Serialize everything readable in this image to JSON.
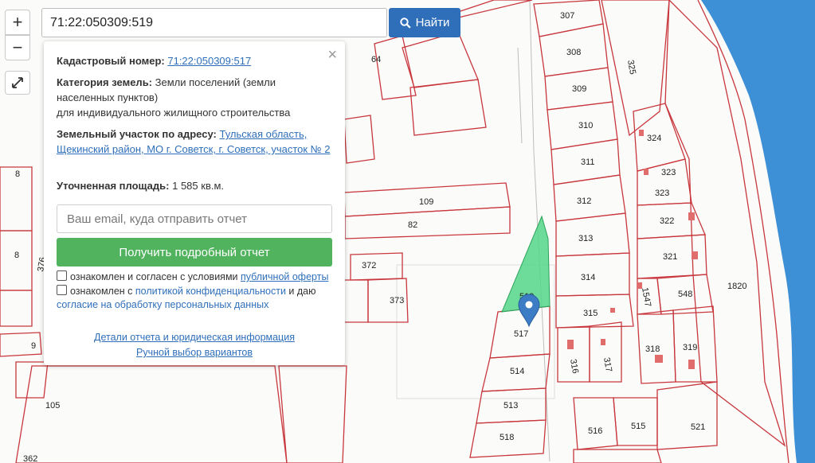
{
  "search": {
    "value": "71:22:050309:519",
    "button_label": "Найти"
  },
  "zoom": {
    "in_label": "+",
    "out_label": "−"
  },
  "popup": {
    "cadastral_label": "Кадастровый номер:",
    "cadastral_value": "71:22:050309:517",
    "category_label": "Категория земель:",
    "category_value": "Земли поселений (земли населенных пунктов)",
    "category_use": "для индивидуального жилищного строительства",
    "address_label": "Земельный участок по адресу:",
    "address_value": "Тульская область, Щекинский район, МО г. Советск, г. Советск, участок № 2",
    "area_label": "Уточненная площадь:",
    "area_value": "1 585 кв.м.",
    "email_placeholder": "Ваш email, куда отправить отчет",
    "report_button": "Получить подробный отчет",
    "consent1_text": "ознакомлен и согласен с условиями ",
    "consent1_link": "публичной оферты",
    "consent2_text": "ознакомлен с ",
    "consent2_link": "политикой конфиденциальности",
    "consent2_text2": " и даю",
    "consent2_link2": "согласие на обработку персональных данных",
    "details_link": "Детали отчета и юридическая информация",
    "manual_link": "Ручной выбор вариантов"
  },
  "map": {
    "plot_color": "#c8373d",
    "highlight_color": "#54d68a",
    "marker_color": "#3b7cc4",
    "water_color": "#3d8fd6",
    "labels": {
      "p307": "307",
      "p308": "308",
      "p309": "309",
      "p310": "310",
      "p311": "311",
      "p312": "312",
      "p313": "313",
      "p314": "314",
      "p315": "315",
      "p316": "316",
      "p317": "317",
      "p318": "318",
      "p319": "319",
      "p321": "321",
      "p322": "322",
      "p323a": "323",
      "p323b": "323",
      "p324": "324",
      "p325": "325",
      "p1820": "1820",
      "p548": "548",
      "p1547": "1547",
      "p109": "109",
      "p82": "82",
      "p372": "372",
      "p373": "373",
      "p64": "64",
      "p517": "517",
      "p514": "514",
      "p513": "513",
      "p518": "518",
      "p516": "516",
      "p515": "515",
      "p521": "521",
      "p105": "105",
      "p362": "362",
      "p8a": "8",
      "p8b": "8",
      "p376": "376",
      "p9": "9",
      "p519": "519"
    }
  }
}
